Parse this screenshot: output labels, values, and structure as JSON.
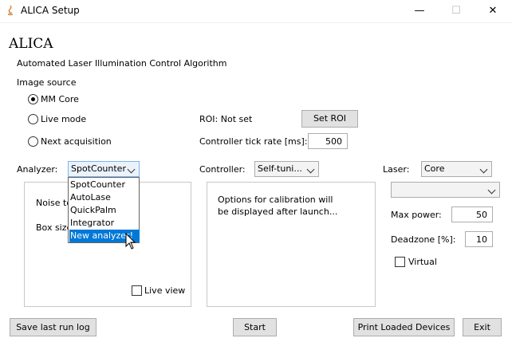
{
  "window": {
    "title": "ALICA Setup",
    "minimize": "—",
    "maximize": "☐",
    "close": "✕"
  },
  "header": {
    "title": "ALICA",
    "subtitle": "Automated Laser Illumination Control Algorithm"
  },
  "image_source": {
    "label": "Image source",
    "options": [
      {
        "label": "MM Core",
        "selected": true
      },
      {
        "label": "Live mode",
        "selected": false
      },
      {
        "label": "Next acquisition",
        "selected": false
      }
    ]
  },
  "roi": {
    "status": "ROI: Not set",
    "button": "Set  ROI"
  },
  "tick_rate": {
    "label": "Controller tick rate [ms]:",
    "value": "500"
  },
  "analyzer": {
    "label": "Analyzer:",
    "value": "SpotCounter",
    "options": [
      "SpotCounter",
      "AutoLase",
      "QuickPalm",
      "Integrator",
      "New analyzer!"
    ],
    "highlighted_index": 4
  },
  "analyzer_panel": {
    "noise_label": "Noise to",
    "box_label": "Box size",
    "live_view": "Live view"
  },
  "controller": {
    "label": "Controller:",
    "value": "Self-tuni...",
    "panel_text_1": "Options for calibration will",
    "panel_text_2": "be displayed after launch..."
  },
  "laser": {
    "label": "Laser:",
    "value": "Core",
    "secondary_value": "",
    "max_power_label": "Max power:",
    "max_power": "50",
    "deadzone_label": "Deadzone [%]:",
    "deadzone": "10",
    "virtual_label": "Virtual"
  },
  "footer": {
    "save_log": "Save last run log",
    "start": "Start",
    "print_devices": "Print Loaded Devices",
    "exit": "Exit"
  },
  "icons": {
    "app": "java-icon",
    "cursor": "mouse-pointer-icon"
  }
}
